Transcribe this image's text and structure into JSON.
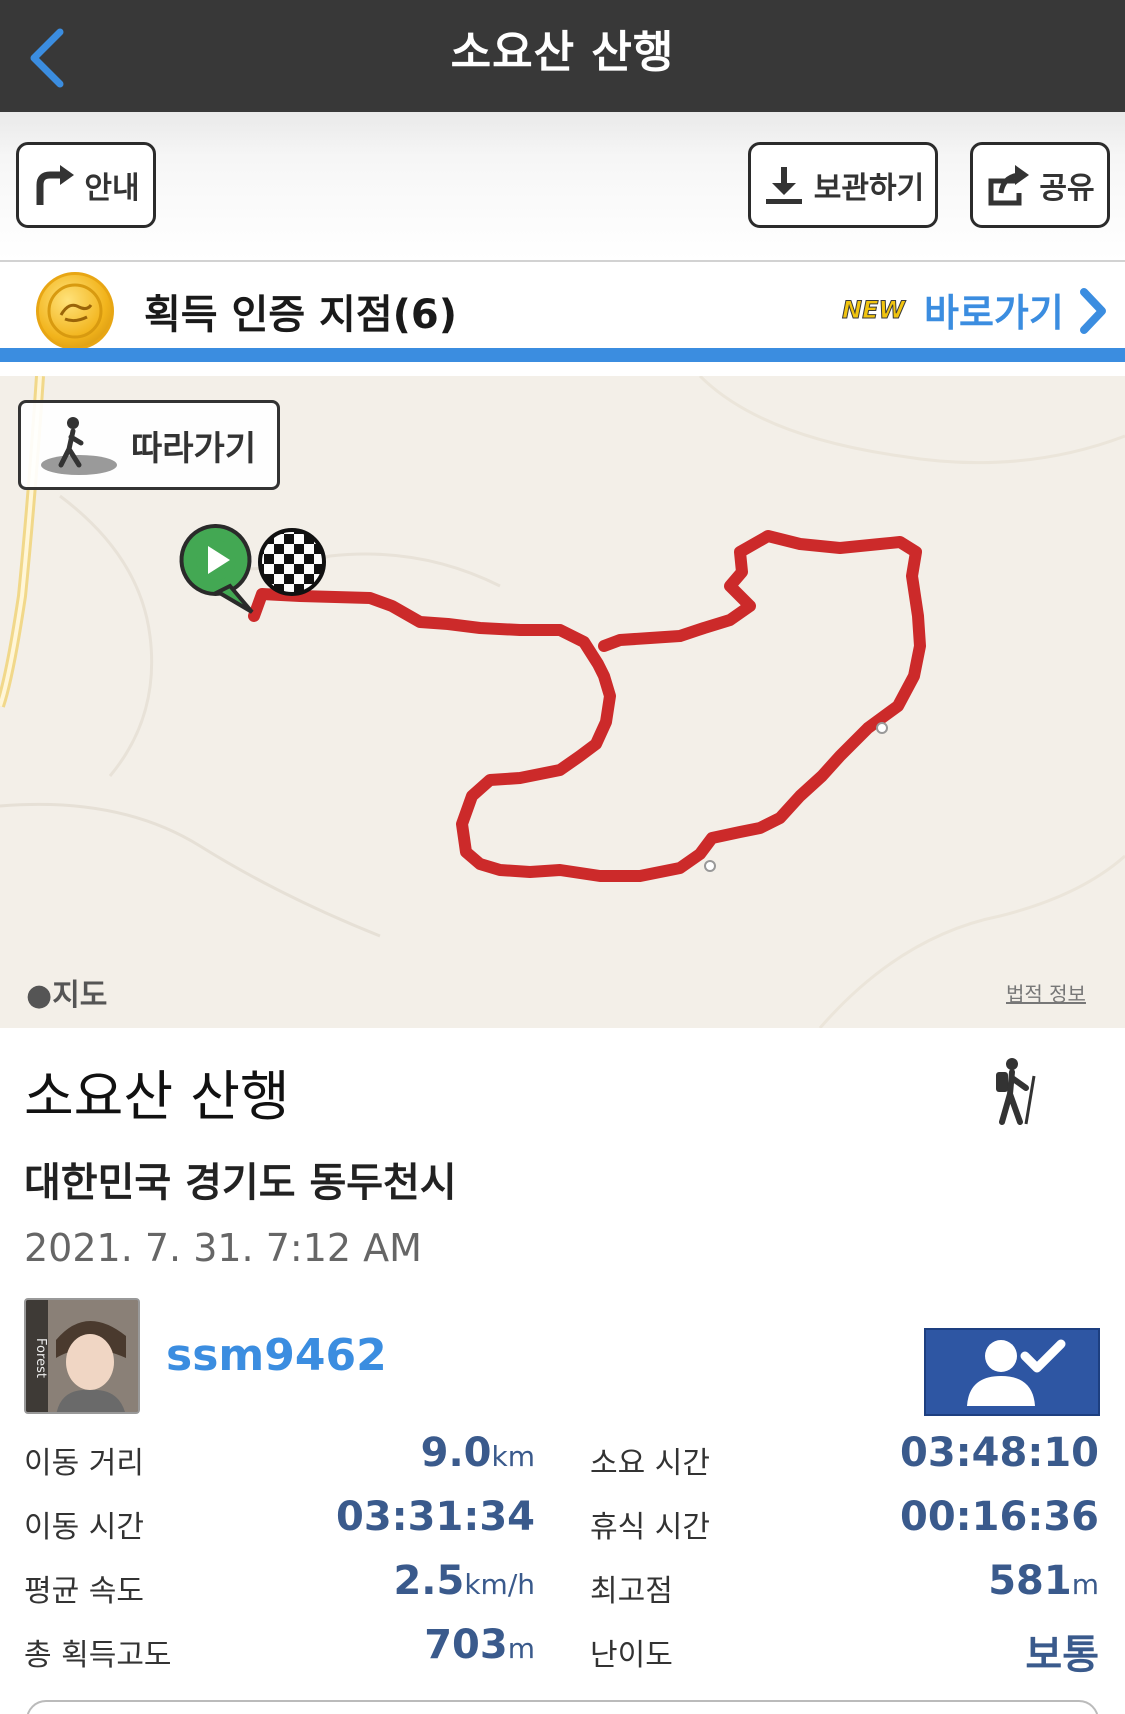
{
  "header": {
    "title": "소요산 산행",
    "back_icon": "chevron-left-icon"
  },
  "toolbar": {
    "guide_label": "안내",
    "save_label": "보관하기",
    "share_label": "공유"
  },
  "badge": {
    "title": "획득 인증 지점(6)",
    "new_tag": "NEW",
    "link_label": "바로가기"
  },
  "map": {
    "follow_label": "따라가기",
    "brand": "지도",
    "legal": "법적 정보",
    "route_color": "#cc2a2a"
  },
  "trip": {
    "title": "소요산 산행",
    "location": "대한민국 경기도 동두천시",
    "datetime": "2021. 7. 31. 7:12 AM",
    "activity_icon": "hiker-icon"
  },
  "user": {
    "name": "ssm9462",
    "avatar_text": "Forest"
  },
  "stats": {
    "distance": {
      "label": "이동 거리",
      "value": "9.0",
      "unit": "km"
    },
    "moving_time": {
      "label": "이동 시간",
      "value": "03:31:34",
      "unit": ""
    },
    "avg_speed": {
      "label": "평균 속도",
      "value": "2.5",
      "unit": "km/h"
    },
    "total_ascent": {
      "label": "총 획득고도",
      "value": "703",
      "unit": "m"
    },
    "total_time": {
      "label": "소요 시간",
      "value": "03:48:10",
      "unit": ""
    },
    "rest_time": {
      "label": "휴식 시간",
      "value": "00:16:36",
      "unit": ""
    },
    "max_altitude": {
      "label": "최고점",
      "value": "581",
      "unit": "m"
    },
    "difficulty": {
      "label": "난이도",
      "value": "보통",
      "unit": ""
    }
  },
  "colors": {
    "accent": "#3b8de0",
    "navbar": "#383838",
    "follow_button": "#2e56a3"
  }
}
